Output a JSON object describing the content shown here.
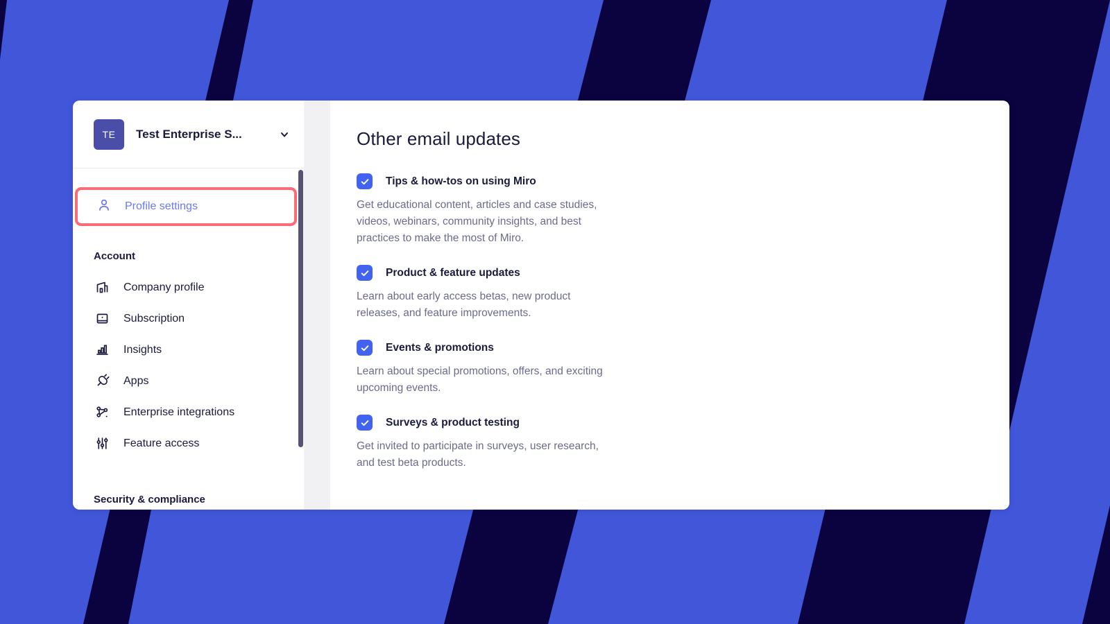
{
  "theme": {
    "background_blue": "#4256da",
    "background_navy": "#0b0340",
    "card_white": "#ffffff",
    "gutter_gray": "#f1f1f3",
    "accent_blue": "#4262f0",
    "highlight_red": "#fb6b76",
    "selected_text_blue": "#6a79f0",
    "text_dark": "#1a1a3d",
    "text_muted": "#6b6b8c",
    "avatar_purple": "#4a4ea8",
    "scrollbar_thumb": "#575273"
  },
  "sidebar": {
    "org": {
      "avatar_initials": "TE",
      "name": "Test Enterprise S...",
      "caret_icon": "chevron-down-icon"
    },
    "selected_item": {
      "label": "Profile settings",
      "icon": "person-icon"
    },
    "sections": [
      {
        "title": "Account",
        "items": [
          {
            "label": "Company profile",
            "icon": "building-icon"
          },
          {
            "label": "Subscription",
            "icon": "card-icon"
          },
          {
            "label": "Insights",
            "icon": "bar-chart-icon"
          },
          {
            "label": "Apps",
            "icon": "plug-icon"
          },
          {
            "label": "Enterprise integrations",
            "icon": "integrations-icon"
          },
          {
            "label": "Feature access",
            "icon": "sliders-icon"
          }
        ]
      },
      {
        "title": "Security & compliance",
        "items": []
      }
    ]
  },
  "main": {
    "heading": "Other email updates",
    "preferences": [
      {
        "label": "Tips & how-tos on using Miro",
        "description": "Get educational content, articles and case studies, videos, webinars, community insights, and best practices to make the most of Miro.",
        "checked": true
      },
      {
        "label": "Product & feature updates",
        "description": "Learn about early access betas, new product releases, and feature improvements.",
        "checked": true
      },
      {
        "label": "Events & promotions",
        "description": "Learn about special promotions, offers, and exciting upcoming events.",
        "checked": true
      },
      {
        "label": "Surveys & product testing",
        "description": "Get invited to participate in surveys, user research, and test beta products.",
        "checked": true
      }
    ]
  }
}
